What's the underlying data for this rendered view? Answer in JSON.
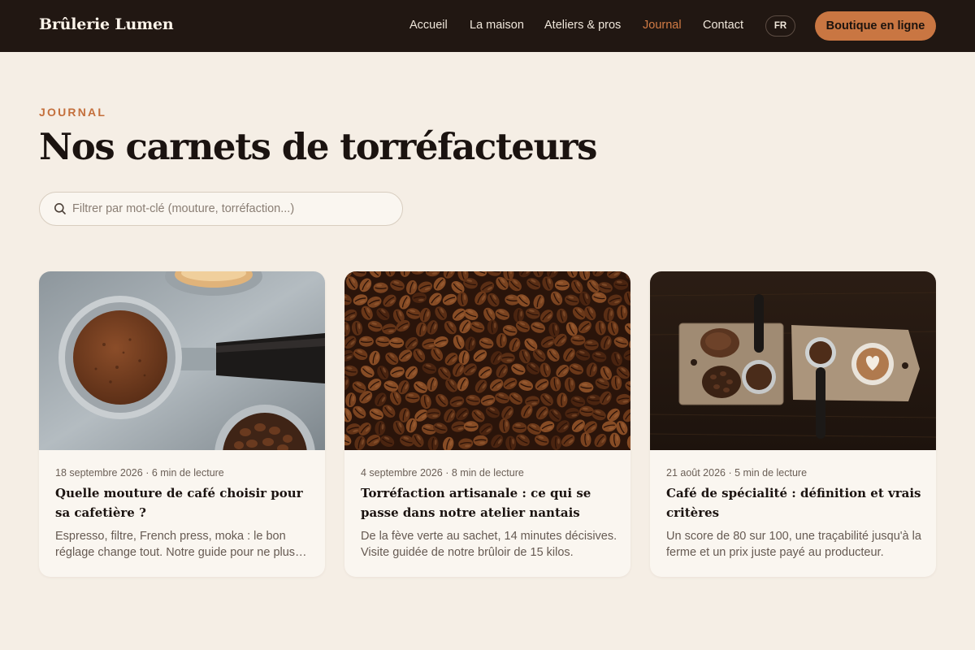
{
  "brand": {
    "name": "Brûlerie Lumen"
  },
  "nav": {
    "items": [
      {
        "label": "Accueil"
      },
      {
        "label": "La maison"
      },
      {
        "label": "Ateliers & pros"
      },
      {
        "label": "Journal",
        "active": true
      },
      {
        "label": "Contact"
      }
    ],
    "language": "FR",
    "shop_label": "Boutique en ligne"
  },
  "hero": {
    "eyebrow": "JOURNAL",
    "title": "Nos carnets de torréfacteurs"
  },
  "search": {
    "placeholder": "Filtrer par mot-clé (mouture, torréfaction...)",
    "value": "",
    "icon": "search-icon"
  },
  "articles": [
    {
      "meta": "18 septembre 2026 · 6 min de lecture",
      "title": "Quelle mouture de café choisir pour sa cafetière ?",
      "excerpt": "Espresso, filtre, French press, moka : le bon réglage change tout. Notre guide pour ne plus rater votre extraction.",
      "image": "portafilters-with-ground-coffee-and-beans"
    },
    {
      "meta": "4 septembre 2026 · 8 min de lecture",
      "title": "Torréfaction artisanale : ce qui se passe dans notre atelier nantais",
      "excerpt": "De la fève verte au sachet, 14 minutes décisives. Visite guidée de notre brûloir de 15 kilos.",
      "image": "roasted-coffee-beans"
    },
    {
      "meta": "21 août 2026 · 5 min de lecture",
      "title": "Café de spécialité : définition et vrais critères",
      "excerpt": "Un score de 80 sur 100, une traçabilité jusqu'à la ferme et un prix juste payé au producteur.",
      "image": "coffee-boards-with-latte-art"
    }
  ],
  "colors": {
    "header_bg": "#211712",
    "page_bg": "#f5eee5",
    "accent": "#c97642",
    "card_bg": "#faf6f0"
  }
}
